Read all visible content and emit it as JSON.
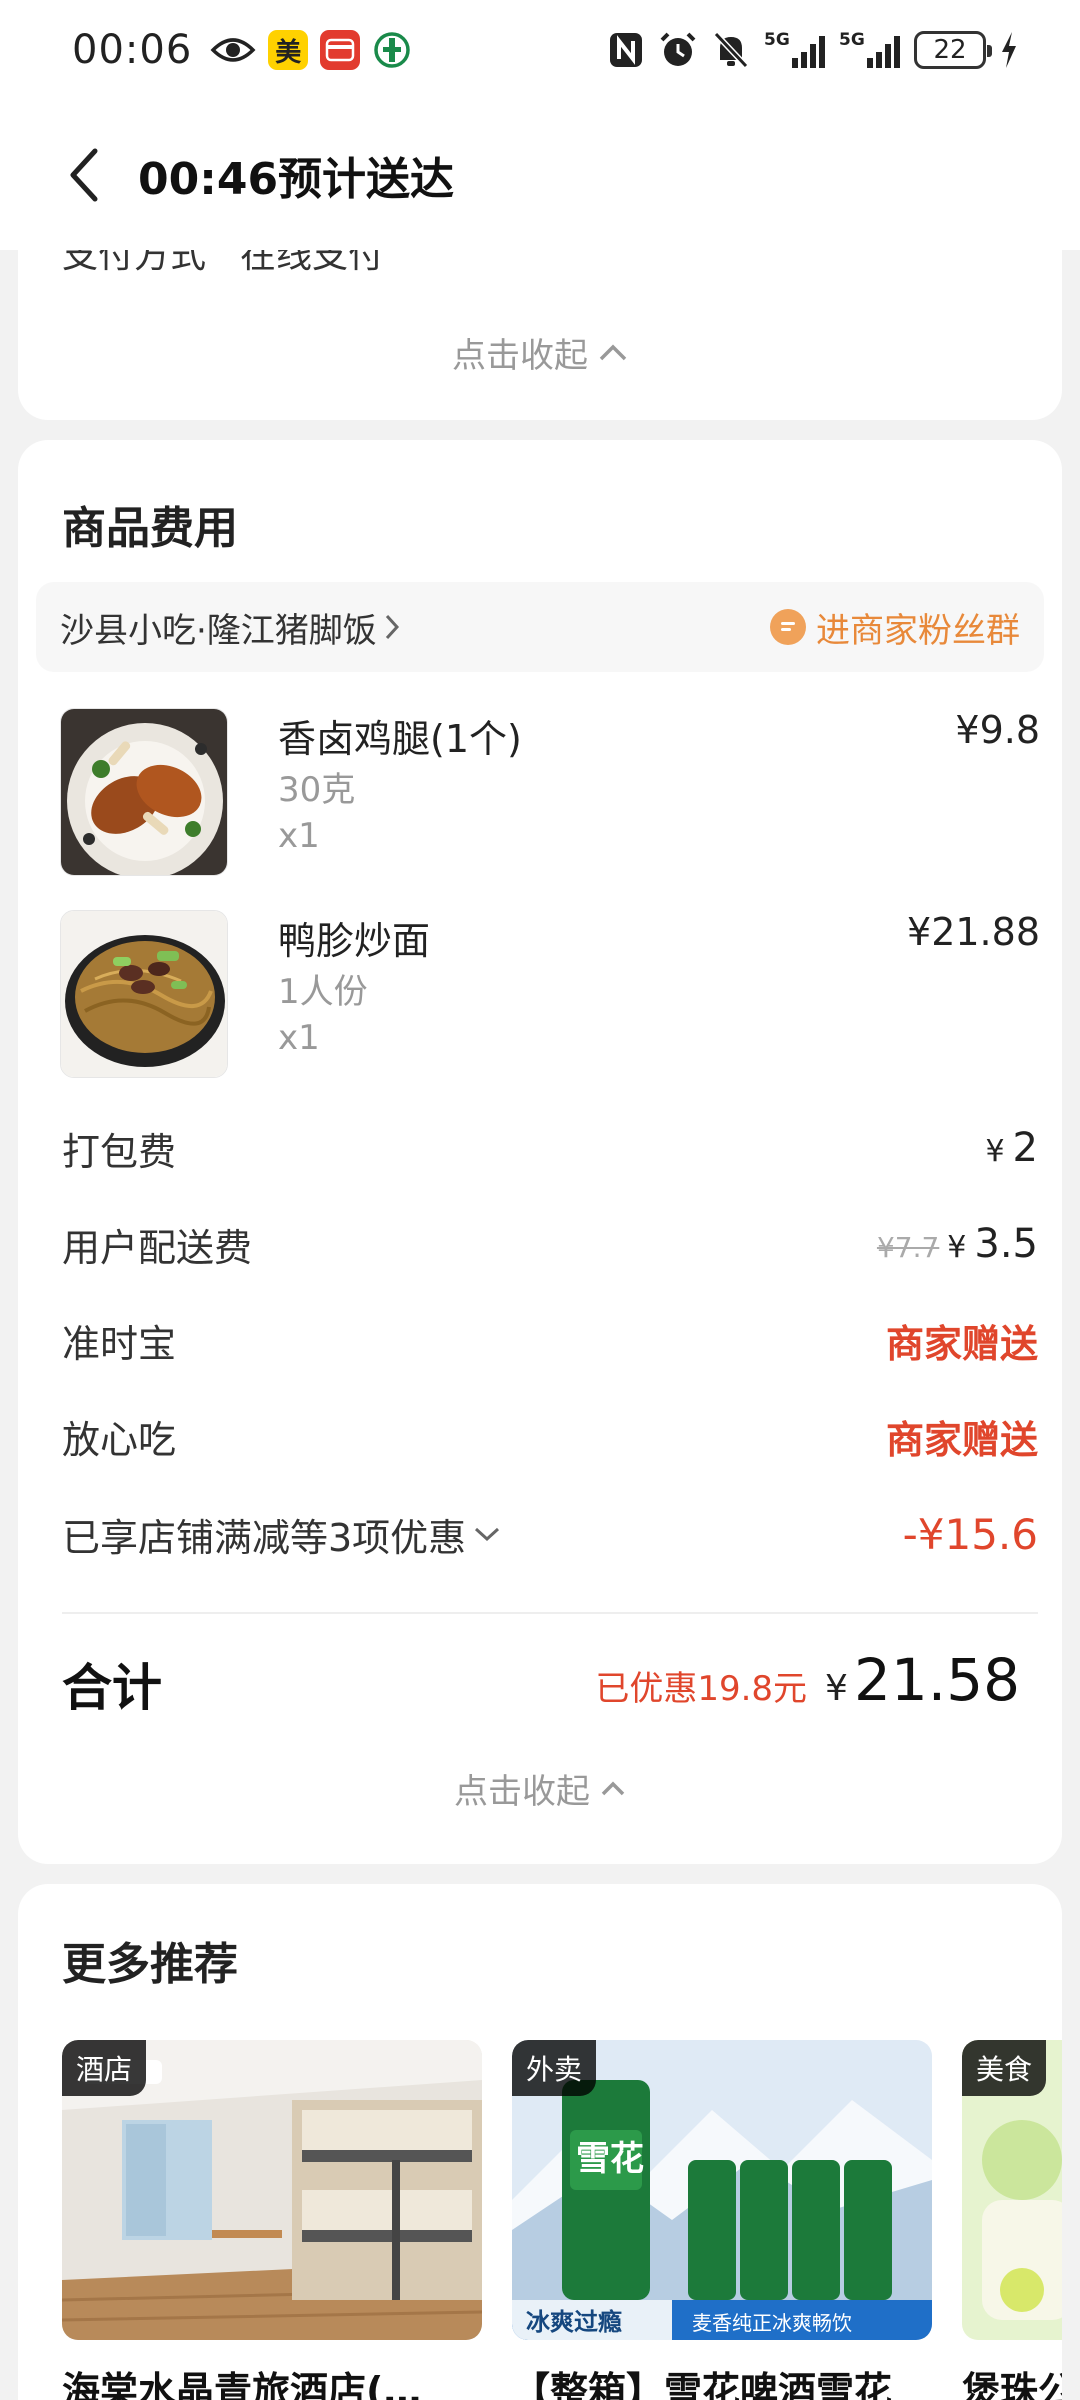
{
  "status_bar": {
    "time": "00:06",
    "app_icons": [
      "美",
      "翼支付"
    ],
    "network": "5G",
    "battery": "22"
  },
  "header": {
    "title": "00:46预计送达"
  },
  "order_info": {
    "payment_label": "支付方式",
    "payment_value": "在线支付",
    "collapse_label": "点击收起"
  },
  "fees": {
    "title": "商品费用",
    "shop_name": "沙县小吃·隆江猪脚饭",
    "fan_group": "进商家粉丝群",
    "items": [
      {
        "name": "香卤鸡腿(1个)",
        "spec": "30克",
        "qty": "x1",
        "price": "¥9.8"
      },
      {
        "name": "鸭胗炒面",
        "spec": "1人份",
        "qty": "x1",
        "price": "¥21.88"
      }
    ],
    "packing": {
      "label": "打包费",
      "yen": "¥",
      "value": "2"
    },
    "delivery": {
      "label": "用户配送费",
      "original": "¥7.7",
      "yen": "¥",
      "value": "3.5"
    },
    "ontime": {
      "label": "准时宝",
      "value": "商家赠送"
    },
    "safe": {
      "label": "放心吃",
      "value": "商家赠送"
    },
    "promo": {
      "label": "已享店铺满减等3项优惠",
      "value": "-¥15.6"
    },
    "total": {
      "label": "合计",
      "saved": "已优惠19.8元",
      "yen": "¥",
      "value": "21.58"
    },
    "collapse_label": "点击收起"
  },
  "recommend": {
    "title": "更多推荐",
    "items": [
      {
        "tag": "酒店",
        "title": "海棠水晶青旅酒店(…"
      },
      {
        "tag": "外卖",
        "title": "【整箱】雪花啤酒雪花",
        "banner_left": "冰爽过瘾",
        "banner_right": "麦香纯正冰爽畅饮",
        "can_text": "雪花"
      },
      {
        "tag": "美食",
        "title": "煲珠公"
      }
    ]
  },
  "colors": {
    "accent_red": "#e0462c",
    "fan_orange": "#e8893a",
    "meituan_yellow": "#ffd100"
  }
}
